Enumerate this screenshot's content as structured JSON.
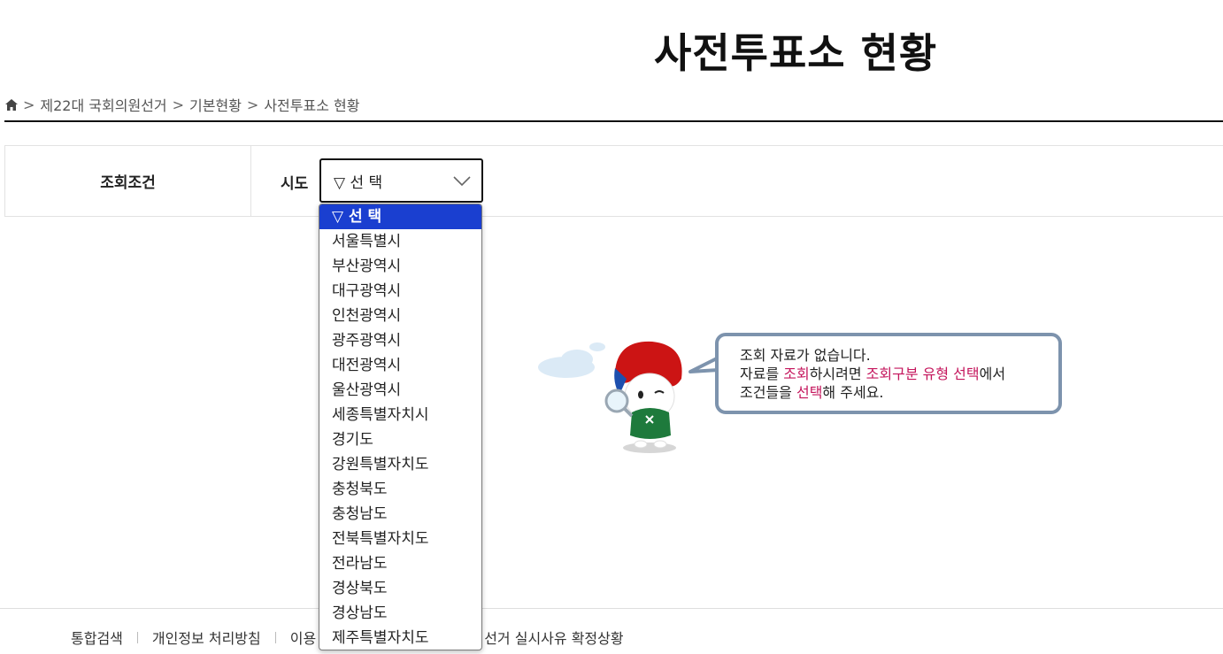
{
  "page": {
    "title": "사전투표소 현황"
  },
  "breadcrumb": {
    "home_icon": "home-icon",
    "items": [
      "제22대 국회의원선거",
      "기본현황",
      "사전투표소 현황"
    ],
    "separator": ">"
  },
  "search": {
    "condition_label": "조회조건",
    "sido_label": "시도",
    "sido_selected": "▽ 선 택"
  },
  "dropdown": {
    "options": [
      "▽ 선 택",
      "서울특별시",
      "부산광역시",
      "대구광역시",
      "인천광역시",
      "광주광역시",
      "대전광역시",
      "울산광역시",
      "세종특별자치시",
      "경기도",
      "강원특별자치도",
      "충청북도",
      "충청남도",
      "전북특별자치도",
      "전라남도",
      "경상북도",
      "경상남도",
      "제주특별자치도"
    ],
    "selected_index": 0,
    "highlight_color": "#1a3fd0"
  },
  "empty_message": {
    "line1": "조회 자료가 없습니다.",
    "line2_parts": [
      "자료를 ",
      "조회",
      "하시려면 ",
      "조회구분 유형 선택",
      "에서"
    ],
    "line3_parts": [
      "조건들을 ",
      "선택",
      "해 주세요."
    ],
    "highlight_color": "#c4155c"
  },
  "footer": {
    "links": [
      "통합검색",
      "개인정보 처리방침",
      "이용",
      "선거 실시사유 확정상황"
    ]
  }
}
